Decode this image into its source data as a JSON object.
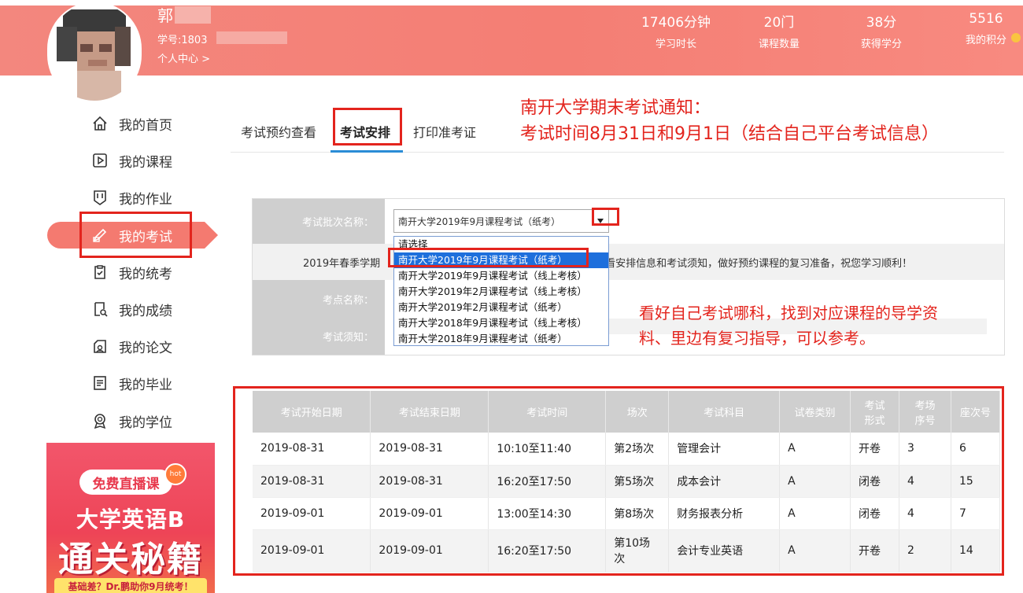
{
  "header": {
    "user_name": "郭",
    "student_id": "学号:1803",
    "personal_center": "个人中心 >",
    "stats": [
      {
        "value": "17406分钟",
        "label": "学习时长"
      },
      {
        "value": "20门",
        "label": "课程数量"
      },
      {
        "value": "38分",
        "label": "获得学分"
      },
      {
        "value": "5516",
        "label": "我的积分"
      }
    ]
  },
  "sidebar": {
    "items": [
      {
        "label": "我的首页",
        "icon": "home-icon"
      },
      {
        "label": "我的课程",
        "icon": "course-icon"
      },
      {
        "label": "我的作业",
        "icon": "homework-icon"
      },
      {
        "label": "我的考试",
        "icon": "exam-icon",
        "active": true
      },
      {
        "label": "我的统考",
        "icon": "unified-exam-icon"
      },
      {
        "label": "我的成绩",
        "icon": "grade-icon"
      },
      {
        "label": "我的论文",
        "icon": "thesis-icon"
      },
      {
        "label": "我的毕业",
        "icon": "graduation-icon"
      },
      {
        "label": "我的学位",
        "icon": "degree-icon"
      }
    ]
  },
  "ad": {
    "live": "免费直播课",
    "hot": "hot",
    "line1": "大学英语B",
    "line2": "通关秘籍",
    "line3": "基础差？Dr.鹏助你9月统考！"
  },
  "tabs": [
    {
      "label": "考试预约查看"
    },
    {
      "label": "考试安排",
      "active": true
    },
    {
      "label": "打印准考证"
    }
  ],
  "annotations": {
    "note1_line1": "南开大学期末考试通知：",
    "note1_line2": "考试时间8月31日和9月1日（结合自己平台考试信息）",
    "note2_line1": "看好自己考试哪科，找到对应课程的导学资",
    "note2_line2": "料、里边有复习指导，可以参考。"
  },
  "form": {
    "batch_label": "考试批次名称：",
    "batch_selected": "南开大学2019年9月课程考试（纸考）",
    "notice_left": "2019年春季学期",
    "notice_right": "看安排信息和考试须知，做好预约课程的复习准备，祝您学习顺利！",
    "site_label": "考点名称：",
    "rules_label": "考试须知：",
    "options": [
      "请选择",
      "南开大学2019年9月课程考试（纸考）",
      "南开大学2019年9月课程考试（线上考核）",
      "南开大学2019年2月课程考试（线上考核）",
      "南开大学2019年2月课程考试（纸考）",
      "南开大学2018年9月课程考试（线上考核）",
      "南开大学2018年9月课程考试（纸考）"
    ],
    "selected_index": 1
  },
  "table": {
    "headers": [
      "考试开始日期",
      "考试结束日期",
      "考试时间",
      "场次",
      "考试科目",
      "试卷类别",
      "考试形式",
      "考场序号",
      "座次号"
    ],
    "rows": [
      [
        "2019-08-31",
        "2019-08-31",
        "10:10至11:40",
        "第2场次",
        "管理会计",
        "A",
        "开卷",
        "3",
        "6"
      ],
      [
        "2019-08-31",
        "2019-08-31",
        "16:20至17:50",
        "第5场次",
        "成本会计",
        "A",
        "闭卷",
        "4",
        "15"
      ],
      [
        "2019-09-01",
        "2019-09-01",
        "13:00至14:30",
        "第8场次",
        "财务报表分析",
        "A",
        "闭卷",
        "4",
        "7"
      ],
      [
        "2019-09-01",
        "2019-09-01",
        "16:20至17:50",
        "第10场次",
        "会计专业英语",
        "A",
        "开卷",
        "2",
        "14"
      ]
    ]
  },
  "colors": {
    "header": "#f47e74",
    "accent_blue": "#2a8cd6",
    "annotation_red": "#e3241d"
  }
}
